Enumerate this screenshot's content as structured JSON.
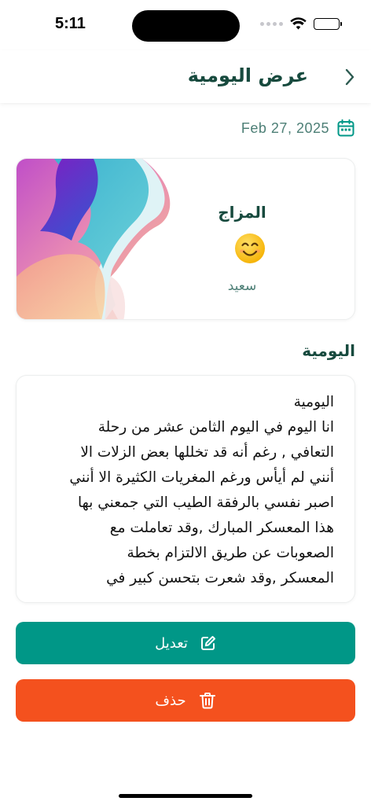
{
  "status_bar": {
    "time": "5:11",
    "icons": [
      "signal-dots-icon",
      "wifi-icon",
      "battery-icon"
    ]
  },
  "header": {
    "title": "عرض اليومية",
    "back_icon": "chevron-icon"
  },
  "entry": {
    "date": "Feb 27, 2025",
    "date_icon": "calendar-icon"
  },
  "mood": {
    "title": "المزاج",
    "emoji": "smiling-face-icon",
    "label": "سعيد"
  },
  "diary": {
    "section_title": "اليومية",
    "lines": [
      "اليومية",
      "انا اليوم في اليوم الثامن عشر من رحلة",
      "التعافي , رغم أنه قد تخللها بعض الزلات الا",
      "أنني لم أيأس ورغم المغريات الكثيرة الا أنني",
      "اصبر نفسي بالرفقة الطيب التي جمعني بها",
      "هذا المعسكر المبارك ,وقد تعاملت مع",
      "الصعوبات عن طريق الالتزام بخطة",
      "المعسكر ,وقد شعرت بتحسن كبير في"
    ]
  },
  "actions": {
    "edit_label": "تعديل",
    "edit_icon": "pencil-square-icon",
    "delete_label": "حذف",
    "delete_icon": "trash-icon"
  },
  "colors": {
    "primary_dark": "#174a3e",
    "muted_green": "#4d7f76",
    "edit_button": "#009787",
    "delete_button": "#f4511e"
  }
}
